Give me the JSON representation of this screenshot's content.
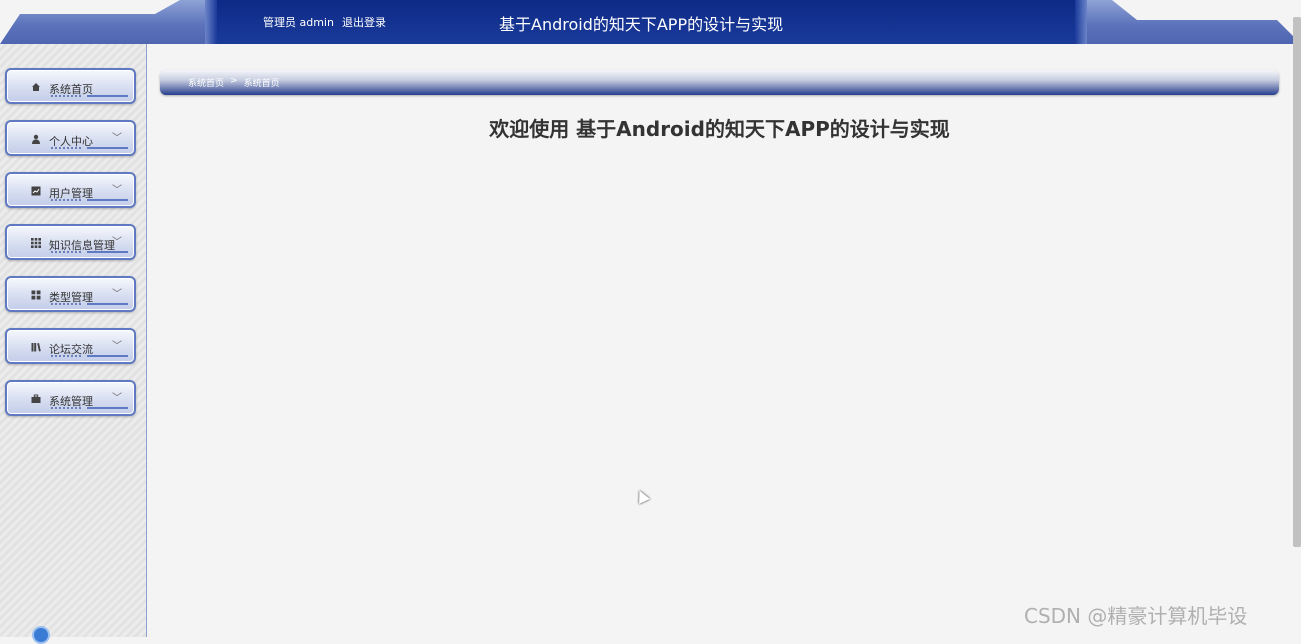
{
  "header": {
    "admin_label": "管理员 admin",
    "logout_label": "退出登录",
    "title": "基于Android的知天下APP的设计与实现"
  },
  "sidebar": {
    "items": [
      {
        "label": "系统首页",
        "icon": "home-icon",
        "has_chevron": false
      },
      {
        "label": "个人中心",
        "icon": "user-icon",
        "has_chevron": true
      },
      {
        "label": "用户管理",
        "icon": "chart-icon",
        "has_chevron": true
      },
      {
        "label": "知识信息管理",
        "icon": "grid-icon",
        "has_chevron": true
      },
      {
        "label": "类型管理",
        "icon": "apps-icon",
        "has_chevron": true
      },
      {
        "label": "论坛交流",
        "icon": "library-icon",
        "has_chevron": true
      },
      {
        "label": "系统管理",
        "icon": "briefcase-icon",
        "has_chevron": true
      }
    ]
  },
  "breadcrumb": {
    "items": [
      "系统首页",
      "系统首页"
    ],
    "separator": ">"
  },
  "main": {
    "welcome": "欢迎使用 基于Android的知天下APP的设计与实现"
  },
  "watermark": "CSDN @精豪计算机毕设",
  "colors": {
    "header_bg": "#0e2a86",
    "accent": "#5f79c2",
    "page_bg": "#f4f4f4"
  }
}
